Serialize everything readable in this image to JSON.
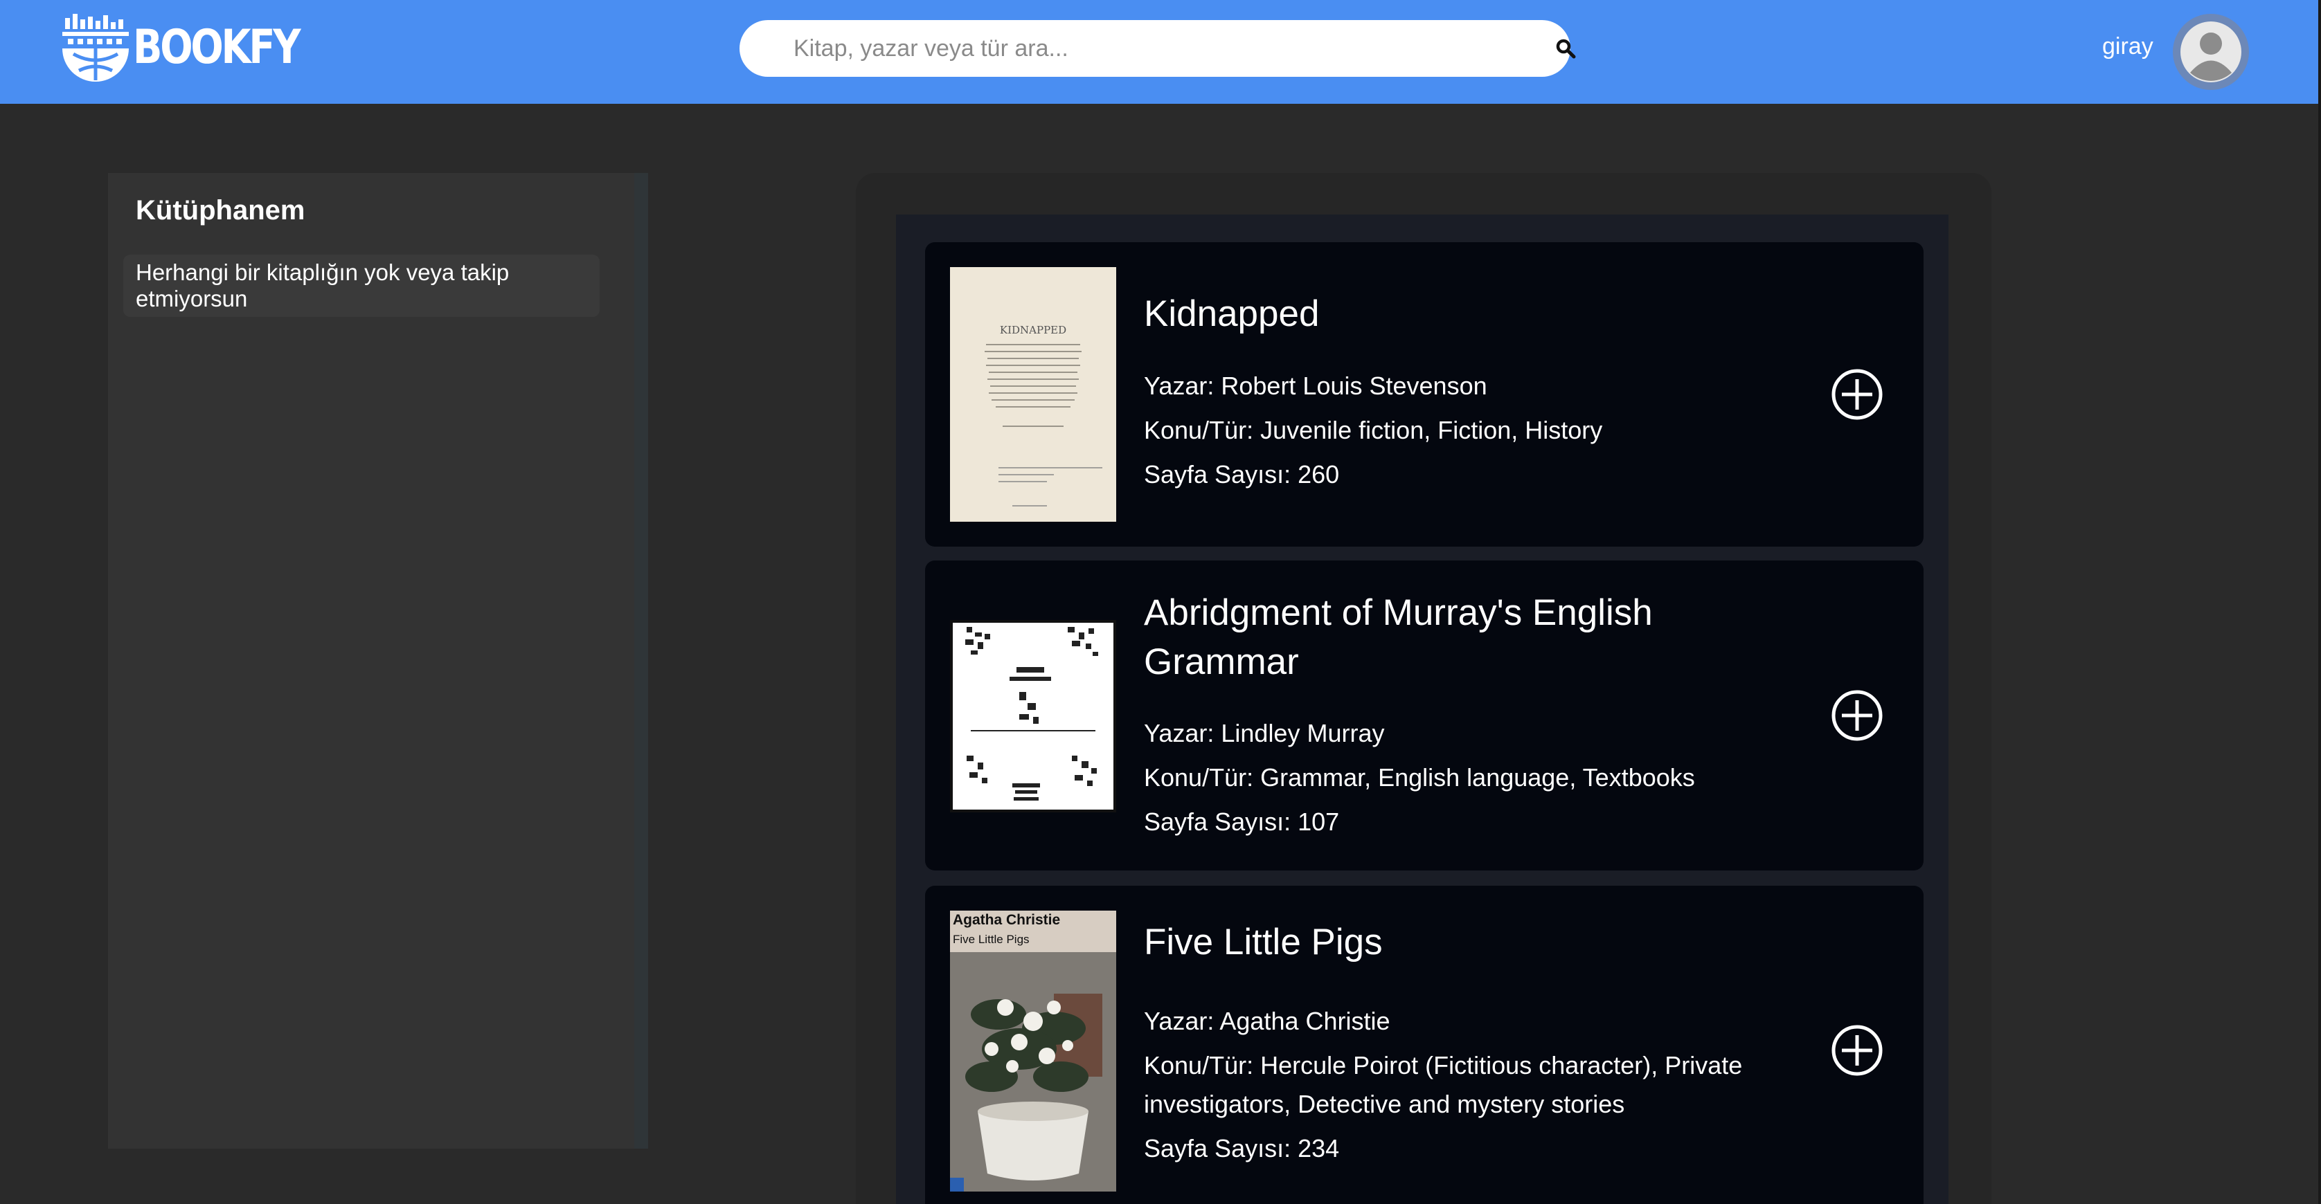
{
  "header": {
    "logo_text": "BOOKFY",
    "search_placeholder": "Kitap, yazar veya tür ara...",
    "username": "giray",
    "accent_color": "#4a8ef2"
  },
  "sidebar": {
    "title": "Kütüphanem",
    "empty_message": "Herhangi bir kitaplığın yok veya takip etmiyorsun"
  },
  "books": [
    {
      "title": "Kidnapped",
      "author_line": "Yazar: Robert Louis Stevenson",
      "subject_line": "Konu/Tür: Juvenile fiction, Fiction, History",
      "pages_line": "Sayfa Sayısı: 260",
      "cover_title": "KIDNAPPED"
    },
    {
      "title": "Abridgment of Murray's English Grammar",
      "author_line": "Yazar: Lindley Murray",
      "subject_line": "Konu/Tür: Grammar, English language, Textbooks",
      "pages_line": "Sayfa Sayısı: 107"
    },
    {
      "title": "Five Little Pigs",
      "author_line": "Yazar: Agatha Christie",
      "subject_line": "Konu/Tür: Hercule Poirot (Fictitious character), Private investigators, Detective and mystery stories",
      "pages_line": "Sayfa Sayısı: 234",
      "cover_author": "Agatha Christie",
      "cover_title": "Five Little Pigs"
    }
  ],
  "icons": {
    "search": "search-icon",
    "add": "plus-circle-icon",
    "avatar": "user-avatar-icon",
    "logo": "bookfy-logo-icon"
  }
}
